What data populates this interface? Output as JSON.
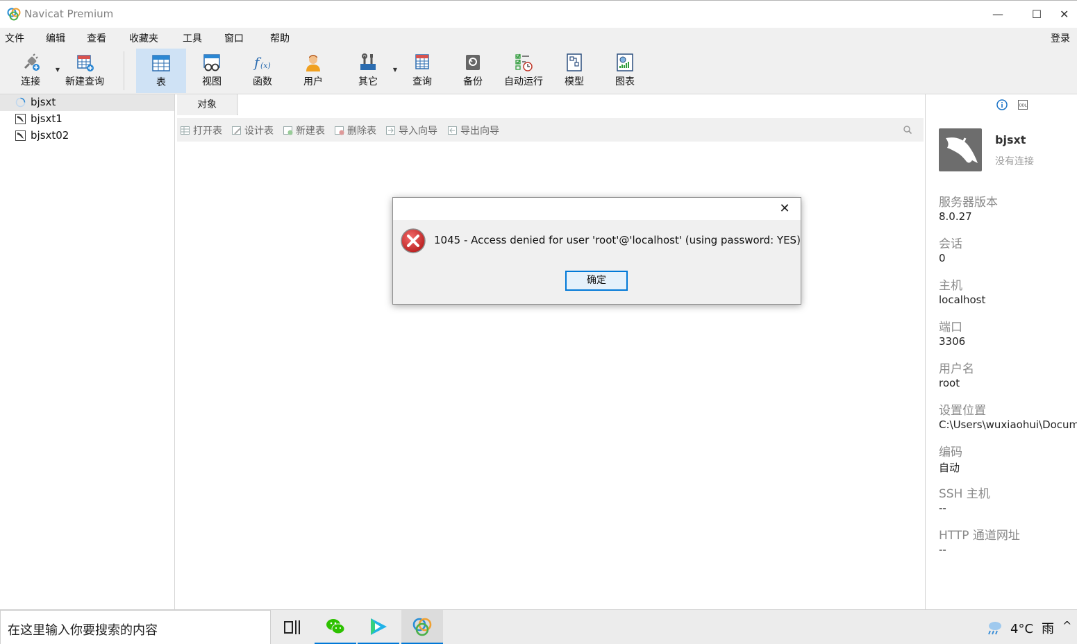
{
  "window": {
    "title": "Navicat Premium",
    "minimize": "—",
    "maximize": "☐",
    "close": "✕"
  },
  "menu": {
    "items": [
      "文件",
      "编辑",
      "查看",
      "收藏夹",
      "工具",
      "窗口",
      "帮助"
    ],
    "login": "登录"
  },
  "toolbar": {
    "connect": "连接",
    "new_query": "新建查询",
    "table": "表",
    "view": "视图",
    "function": "函数",
    "user": "用户",
    "other": "其它",
    "query": "查询",
    "backup": "备份",
    "automation": "自动运行",
    "model": "模型",
    "chart": "图表"
  },
  "tree": {
    "items": [
      "bjsxt",
      "bjsxt1",
      "bjsxt02"
    ],
    "selected": "bjsxt"
  },
  "tabs": {
    "objects": "对象"
  },
  "object_toolbar": {
    "open_table": "打开表",
    "design_table": "设计表",
    "new_table": "新建表",
    "delete_table": "删除表",
    "import_wizard": "导入向导",
    "export_wizard": "导出向导"
  },
  "info_panel": {
    "name": "bjsxt",
    "status": "没有连接",
    "fields": [
      {
        "key": "服务器版本",
        "value": "8.0.27"
      },
      {
        "key": "会话",
        "value": "0"
      },
      {
        "key": "主机",
        "value": "localhost"
      },
      {
        "key": "端口",
        "value": "3306"
      },
      {
        "key": "用户名",
        "value": "root"
      },
      {
        "key": "设置位置",
        "value": "C:\\Users\\wuxiaohui\\Docume"
      },
      {
        "key": "编码",
        "value": "自动"
      },
      {
        "key": "SSH 主机",
        "value": "--"
      },
      {
        "key": "HTTP 通道网址",
        "value": "--"
      }
    ]
  },
  "dialog": {
    "message": "1045 - Access denied for user 'root'@'localhost' (using password: YES)",
    "ok": "确定",
    "close": "✕"
  },
  "taskbar": {
    "search_placeholder": "在这里输入你要搜索的内容",
    "weather_temp": "4°C",
    "weather_condition": "雨",
    "tray_arrow": "^"
  },
  "colors": {
    "accent": "#0078d7",
    "error": "#c62828",
    "selected_tool": "#cfe2f5"
  }
}
